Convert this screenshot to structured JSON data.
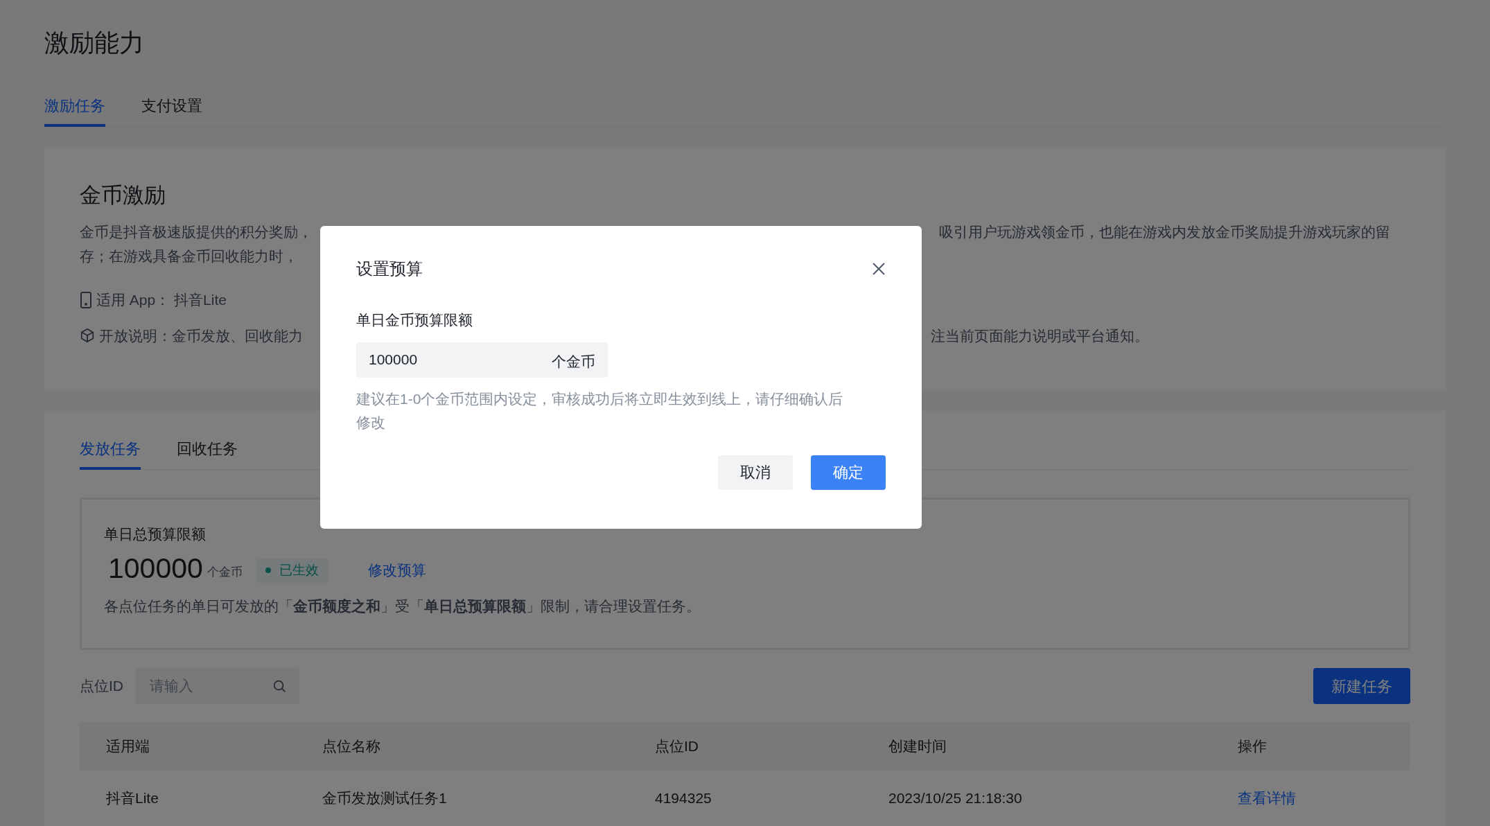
{
  "page_title": "激励能力",
  "tabs": [
    {
      "label": "激励任务",
      "selected": true
    },
    {
      "label": "支付设置",
      "selected": false
    }
  ],
  "intro_card": {
    "title": "金币激励",
    "description_lines": [
      {
        "left": "金币是抖音极速版提供的积分奖励，",
        "right": "吸引用户玩游戏领金币，也能在游戏内发放金币奖励提升游戏玩家的留"
      },
      {
        "left": "存；在游戏具备金币回收能力时，"
      }
    ],
    "app_line": "适用 App： 抖音Lite",
    "open_line": {
      "left": "开放说明：金币发放、回收能力",
      "right": "注当前页面能力说明或平台通知。"
    }
  },
  "task_tabs": [
    {
      "label": "发放任务",
      "selected": true
    },
    {
      "label": "回收任务",
      "selected": false
    }
  ],
  "budget": {
    "label": "单日总预算限额",
    "amount": "100000",
    "unit": "个金币",
    "status": "已生效",
    "edit_link": "修改预算",
    "note": "各点位任务的单日可发放的「**金币额度之和**」受「**单日总预算限额**」限制，请合理设置任务。"
  },
  "filter": {
    "label": "点位ID",
    "placeholder": "请输入"
  },
  "new_button": "新建任务",
  "table": {
    "columns": [
      "适用端",
      "点位名称",
      "点位ID",
      "创建时间",
      "操作"
    ],
    "rows": [
      {
        "platform": "抖音Lite",
        "name": "金币发放测试任务1",
        "id": "4194325",
        "created": "2023/10/25 21:18:30",
        "action": "查看详情"
      }
    ]
  },
  "dialog": {
    "title": "设置预算",
    "field_label": "单日金币预算限额",
    "value": "100000",
    "suffix": "个金币",
    "hint": "建议在1-0个金币范围内设定，审核成功后将立即生效到线上，请仔细确认后修改",
    "cancel": "取消",
    "confirm": "确定"
  }
}
